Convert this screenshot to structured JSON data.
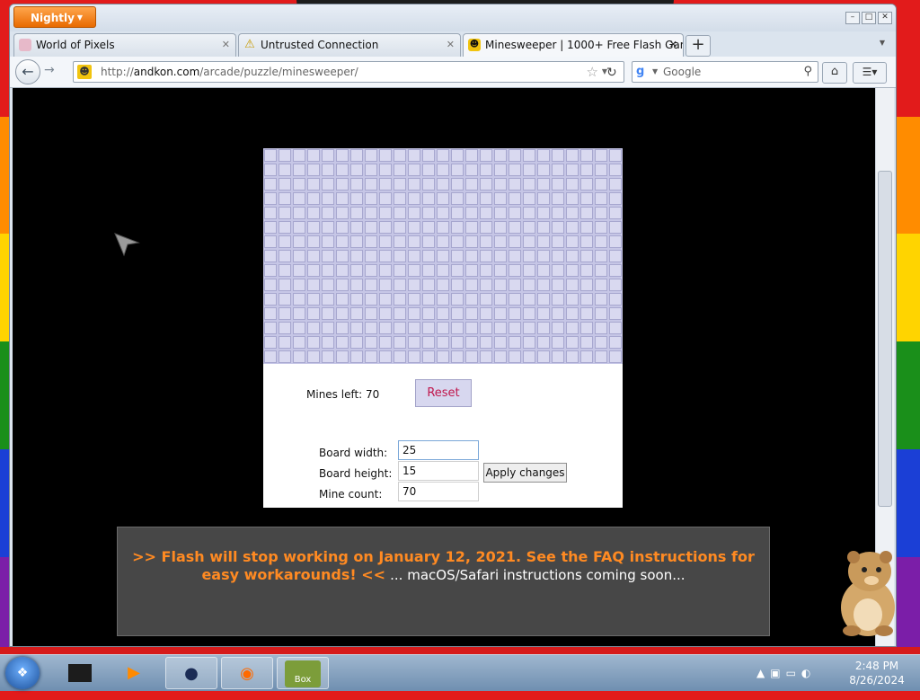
{
  "browser": {
    "app_button": "Nightly",
    "tabs": [
      {
        "title": "World of Pixels",
        "icon": "pixel-favicon"
      },
      {
        "title": "Untrusted Connection",
        "icon": "warning-icon"
      },
      {
        "title": "Minesweeper | 1000+ Free Flash Gam...",
        "icon": "andkon-favicon",
        "active": true
      }
    ],
    "url": {
      "prefix": "http://",
      "domain": "andkon.com",
      "path": "/arcade/puzzle/minesweeper/"
    },
    "search_placeholder": "Google"
  },
  "game": {
    "grid": {
      "columns": 25,
      "rows": 15
    },
    "mines_left_label": "Mines left: 70",
    "reset_label": "Reset",
    "board_width_label": "Board width:",
    "board_width_value": "25",
    "board_height_label": "Board height:",
    "board_height_value": "15",
    "mine_count_label": "Mine count:",
    "mine_count_value": "70",
    "apply_label": "Apply changes"
  },
  "notice": {
    "warning_text": ">> Flash will stop working on January 12, 2021. See the FAQ instructions for easy workarounds! <<",
    "rest_text": "... macOS/Safari instructions coming soon..."
  },
  "taskbar": {
    "time": "2:48 PM",
    "date": "8/26/2024",
    "pinned_label": "Box"
  },
  "colors": {
    "accent_orange": "#ff8a22",
    "reset_text": "#c0164c",
    "cell": "#d9d9f0"
  }
}
